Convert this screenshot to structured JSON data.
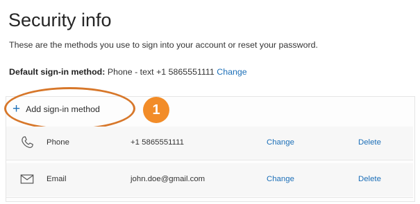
{
  "header": {
    "title": "Security info",
    "description": "These are the methods you use to sign into your account or reset your password."
  },
  "default_method": {
    "label": "Default sign-in method:",
    "value": "Phone - text +1 5865551111",
    "change_label": "Change"
  },
  "add_method": {
    "label": "Add sign-in method",
    "icon": "plus-icon"
  },
  "annotation": {
    "step": "1",
    "color": "#f28c28"
  },
  "methods": [
    {
      "icon": "phone-icon",
      "name": "Phone",
      "value": "+1 5865551111",
      "change_label": "Change",
      "delete_label": "Delete"
    },
    {
      "icon": "mail-icon",
      "name": "Email",
      "value": "john.doe@gmail.com",
      "change_label": "Change",
      "delete_label": "Delete"
    }
  ],
  "colors": {
    "link": "#1c6fb8",
    "accent": "#f28c28"
  }
}
